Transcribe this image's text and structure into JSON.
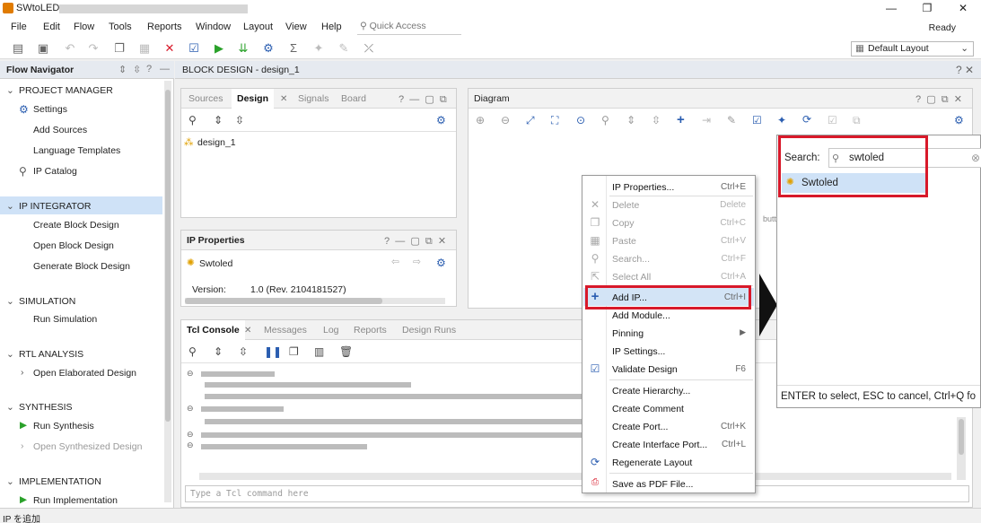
{
  "window": {
    "title": "SWtoLED -",
    "status_right": "Ready"
  },
  "menu": [
    "File",
    "Edit",
    "Flow",
    "Tools",
    "Reports",
    "Window",
    "Layout",
    "View",
    "Help"
  ],
  "quick_access": {
    "placeholder": "Quick Access"
  },
  "layout_selector": {
    "value": "Default Layout"
  },
  "flow_navigator": {
    "title": "Flow Navigator",
    "sections": [
      {
        "label": "PROJECT MANAGER",
        "items": [
          "Settings",
          "Add Sources",
          "Language Templates",
          "IP Catalog"
        ]
      },
      {
        "label": "IP INTEGRATOR",
        "items": [
          "Create Block Design",
          "Open Block Design",
          "Generate Block Design"
        ]
      },
      {
        "label": "SIMULATION",
        "items": [
          "Run Simulation"
        ]
      },
      {
        "label": "RTL ANALYSIS",
        "items": [
          "Open Elaborated Design"
        ]
      },
      {
        "label": "SYNTHESIS",
        "items": [
          "Run Synthesis",
          "Open Synthesized Design"
        ]
      },
      {
        "label": "IMPLEMENTATION",
        "items": [
          "Run Implementation"
        ]
      }
    ]
  },
  "block_design": {
    "title": "BLOCK DESIGN - design_1"
  },
  "sources_panel": {
    "tabs": [
      "Sources",
      "Design",
      "Signals",
      "Board"
    ],
    "active": "Design",
    "tree_item": "design_1"
  },
  "ip_properties": {
    "title": "IP Properties",
    "name": "Swtoled",
    "version_label": "Version:",
    "version_value": "1.0 (Rev. 2104181527)"
  },
  "diagram": {
    "title": "Diagram",
    "partial_text": "butt"
  },
  "tcl_console": {
    "tabs": [
      "Tcl Console",
      "Messages",
      "Log",
      "Reports",
      "Design Runs"
    ],
    "active": "Tcl Console",
    "input_placeholder": "Type a Tcl command here"
  },
  "context_menu": {
    "items": [
      {
        "label": "IP Properties...",
        "shortcut": "Ctrl+E",
        "enabled": true
      },
      {
        "label": "Delete",
        "shortcut": "Delete",
        "enabled": false
      },
      {
        "label": "Copy",
        "shortcut": "Ctrl+C",
        "enabled": false
      },
      {
        "label": "Paste",
        "shortcut": "Ctrl+V",
        "enabled": false
      },
      {
        "label": "Search...",
        "shortcut": "Ctrl+F",
        "enabled": false
      },
      {
        "label": "Select All",
        "shortcut": "Ctrl+A",
        "enabled": false
      },
      {
        "label": "Add IP...",
        "shortcut": "Ctrl+I",
        "enabled": true
      },
      {
        "label": "Add Module...",
        "shortcut": "",
        "enabled": true
      },
      {
        "label": "Pinning",
        "shortcut": "",
        "enabled": true
      },
      {
        "label": "IP Settings...",
        "shortcut": "",
        "enabled": true
      },
      {
        "label": "Validate Design",
        "shortcut": "F6",
        "enabled": true
      },
      {
        "label": "Create Hierarchy...",
        "shortcut": "",
        "enabled": true
      },
      {
        "label": "Create Comment",
        "shortcut": "",
        "enabled": true
      },
      {
        "label": "Create Port...",
        "shortcut": "Ctrl+K",
        "enabled": true
      },
      {
        "label": "Create Interface Port...",
        "shortcut": "Ctrl+L",
        "enabled": true
      },
      {
        "label": "Regenerate Layout",
        "shortcut": "",
        "enabled": true
      },
      {
        "label": "Save as PDF File...",
        "shortcut": "",
        "enabled": true
      }
    ]
  },
  "ip_search": {
    "label": "Search:",
    "value": "swtoled",
    "result": "Swtoled",
    "hint": "ENTER to select, ESC to cancel, Ctrl+Q fo"
  },
  "status_bar": {
    "text": "IP を追加"
  }
}
